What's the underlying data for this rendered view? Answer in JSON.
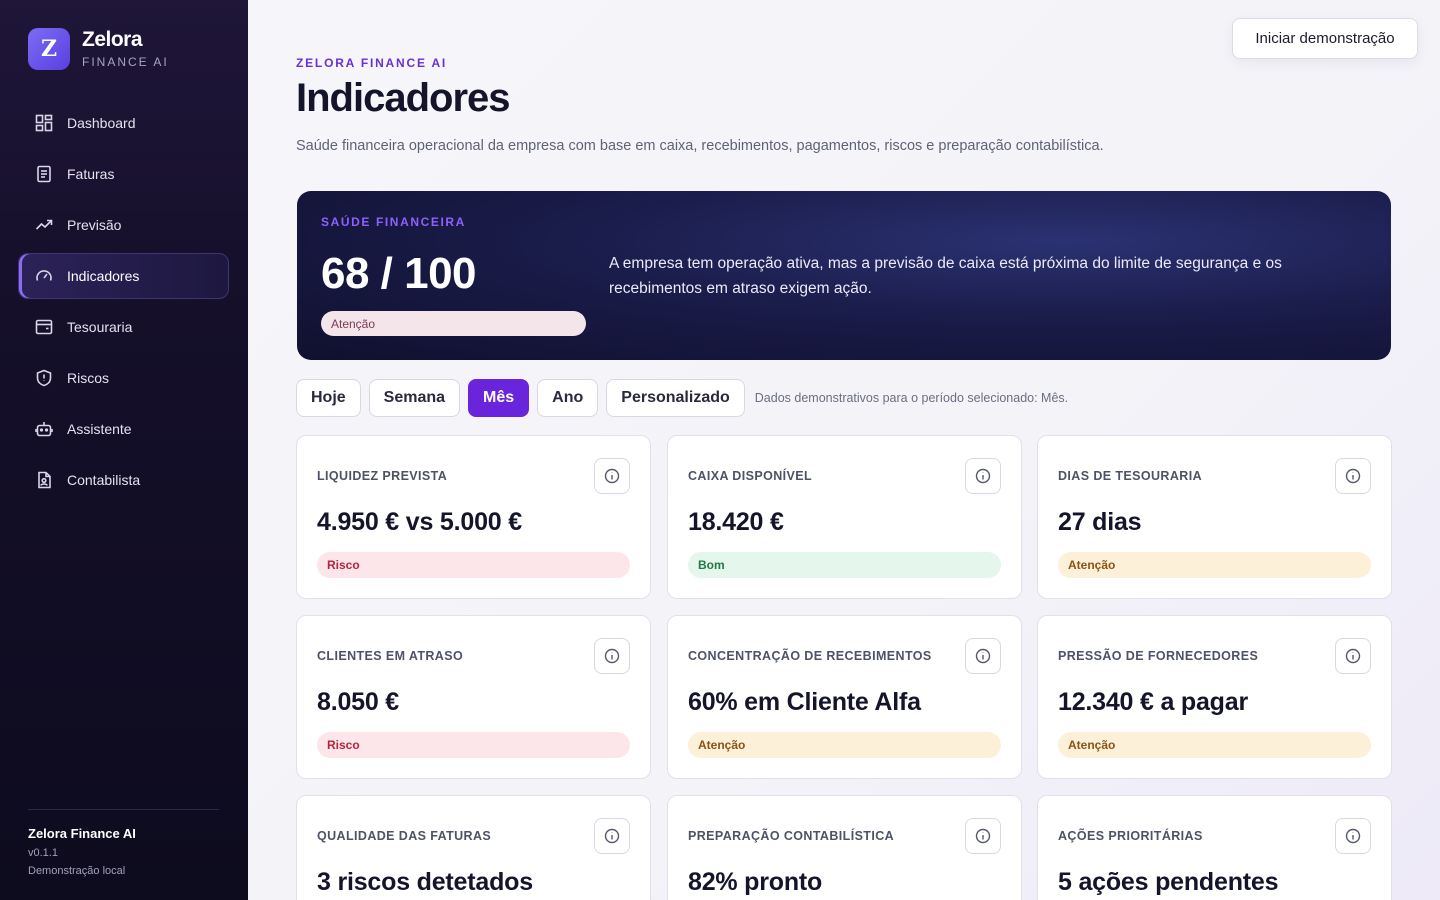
{
  "brand": {
    "name": "Zelora",
    "sub": "FINANCE AI",
    "logo_letter": "Z"
  },
  "nav": [
    {
      "label": "Dashboard",
      "icon": "dashboard-icon"
    },
    {
      "label": "Faturas",
      "icon": "invoice-icon"
    },
    {
      "label": "Previsão",
      "icon": "trend-icon"
    },
    {
      "label": "Indicadores",
      "icon": "gauge-icon",
      "active": true
    },
    {
      "label": "Tesouraria",
      "icon": "wallet-icon"
    },
    {
      "label": "Riscos",
      "icon": "shield-icon"
    },
    {
      "label": "Assistente",
      "icon": "bot-icon"
    },
    {
      "label": "Contabilista",
      "icon": "document-user-icon"
    }
  ],
  "footer": {
    "name": "Zelora Finance AI",
    "version": "v0.1.1",
    "mode": "Demonstração local"
  },
  "header": {
    "demo_button": "Iniciar demonstração",
    "eyebrow": "ZELORA FINANCE AI",
    "title": "Indicadores",
    "description": "Saúde financeira operacional da empresa com base em caixa, recebimentos, pagamentos, riscos e preparação contabilística."
  },
  "health": {
    "eyebrow": "SAÚDE FINANCEIRA",
    "score": "68 / 100",
    "status": "Atenção",
    "summary": "A empresa tem operação ativa, mas a previsão de caixa está próxima do limite de segurança e os recebimentos em atraso exigem ação."
  },
  "filters": {
    "options": [
      "Hoje",
      "Semana",
      "Mês",
      "Ano",
      "Personalizado"
    ],
    "selected": "Mês",
    "note": "Dados demonstrativos para o período selecionado: Mês."
  },
  "cards": [
    {
      "label": "LIQUIDEZ PREVISTA",
      "value": "4.950 € vs 5.000 €",
      "status": "Risco",
      "kind": "risk"
    },
    {
      "label": "CAIXA DISPONÍVEL",
      "value": "18.420 €",
      "status": "Bom",
      "kind": "good"
    },
    {
      "label": "DIAS DE TESOURARIA",
      "value": "27 dias",
      "status": "Atenção",
      "kind": "warn"
    },
    {
      "label": "CLIENTES EM ATRASO",
      "value": "8.050 €",
      "status": "Risco",
      "kind": "risk"
    },
    {
      "label": "CONCENTRAÇÃO DE RECEBIMENTOS",
      "value": "60% em Cliente Alfa",
      "status": "Atenção",
      "kind": "warn"
    },
    {
      "label": "PRESSÃO DE FORNECEDORES",
      "value": "12.340 € a pagar",
      "status": "Atenção",
      "kind": "warn"
    },
    {
      "label": "QUALIDADE DAS FATURAS",
      "value": "3 riscos detetados",
      "status": "",
      "kind": "warn"
    },
    {
      "label": "PREPARAÇÃO CONTABILÍSTICA",
      "value": "82% pronto",
      "status": "",
      "kind": "warn"
    },
    {
      "label": "AÇÕES PRIORITÁRIAS",
      "value": "5 ações pendentes",
      "status": "",
      "kind": "warn"
    }
  ]
}
